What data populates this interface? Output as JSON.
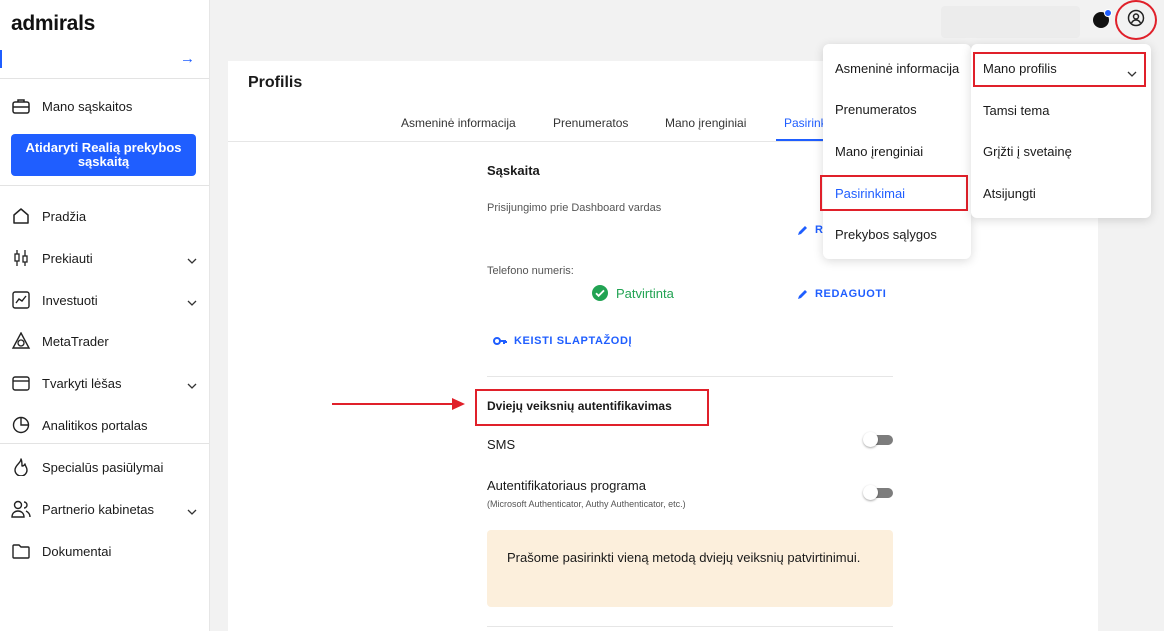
{
  "brand": {
    "logo": "admirals"
  },
  "sidebar": {
    "accounts_label": "Mano sąskaitos",
    "cta_label": "Atidaryti Realią prekybos sąskaitą",
    "items": [
      {
        "label": "Pradžia",
        "icon": "home-icon"
      },
      {
        "label": "Prekiauti",
        "icon": "candlestick-icon"
      },
      {
        "label": "Investuoti",
        "icon": "chart-icon"
      },
      {
        "label": "MetaTrader",
        "icon": "metatrader-icon"
      },
      {
        "label": "Tvarkyti lėšas",
        "icon": "wallet-icon"
      },
      {
        "label": "Analitikos portalas",
        "icon": "pie-chart-icon"
      },
      {
        "label": "Specialūs pasiūlymai",
        "icon": "flame-icon"
      },
      {
        "label": "Partnerio kabinetas",
        "icon": "people-icon"
      },
      {
        "label": "Dokumentai",
        "icon": "folder-icon"
      }
    ]
  },
  "page": {
    "title": "Profilis",
    "tabs": [
      {
        "label": "Asmeninė informacija"
      },
      {
        "label": "Prenumeratos"
      },
      {
        "label": "Mano įrenginiai"
      },
      {
        "label": "Pasirinki"
      }
    ]
  },
  "account_section": {
    "title": "Sąskaita",
    "login_label": "Prisijungimo prie Dashboard vardas",
    "login_edit_label": "R",
    "phone_label": "Telefono numeris:",
    "phone_status": "Patvirtinta",
    "edit_label": "REDAGUOTI",
    "change_password_label": "KEISTI SLAPTAŽODĮ"
  },
  "twofa_section": {
    "title": "Dviejų veiksnių autentifikavimas",
    "sms_label": "SMS",
    "app_label": "Autentifikatoriaus programa",
    "app_sub": "(Microsoft Authenticator, Authy Authenticator, etc.)",
    "notice": "Prašome pasirinkti vieną metodą dviejų veiksnių patvirtinimui."
  },
  "menu_left": {
    "items": [
      {
        "label": "Asmeninė informacija"
      },
      {
        "label": "Prenumeratos"
      },
      {
        "label": "Mano įrenginiai"
      },
      {
        "label": "Pasirinkimai"
      },
      {
        "label": "Prekybos sąlygos"
      }
    ]
  },
  "menu_right": {
    "items": [
      {
        "label": "Mano profilis"
      },
      {
        "label": "Tamsi tema"
      },
      {
        "label": "Grįžti į svetainę"
      },
      {
        "label": "Atsijungti"
      }
    ]
  },
  "colors": {
    "accent": "#1f5eff",
    "highlight": "#e0202a",
    "success": "#22a353",
    "notice_bg": "#fcefdc"
  }
}
